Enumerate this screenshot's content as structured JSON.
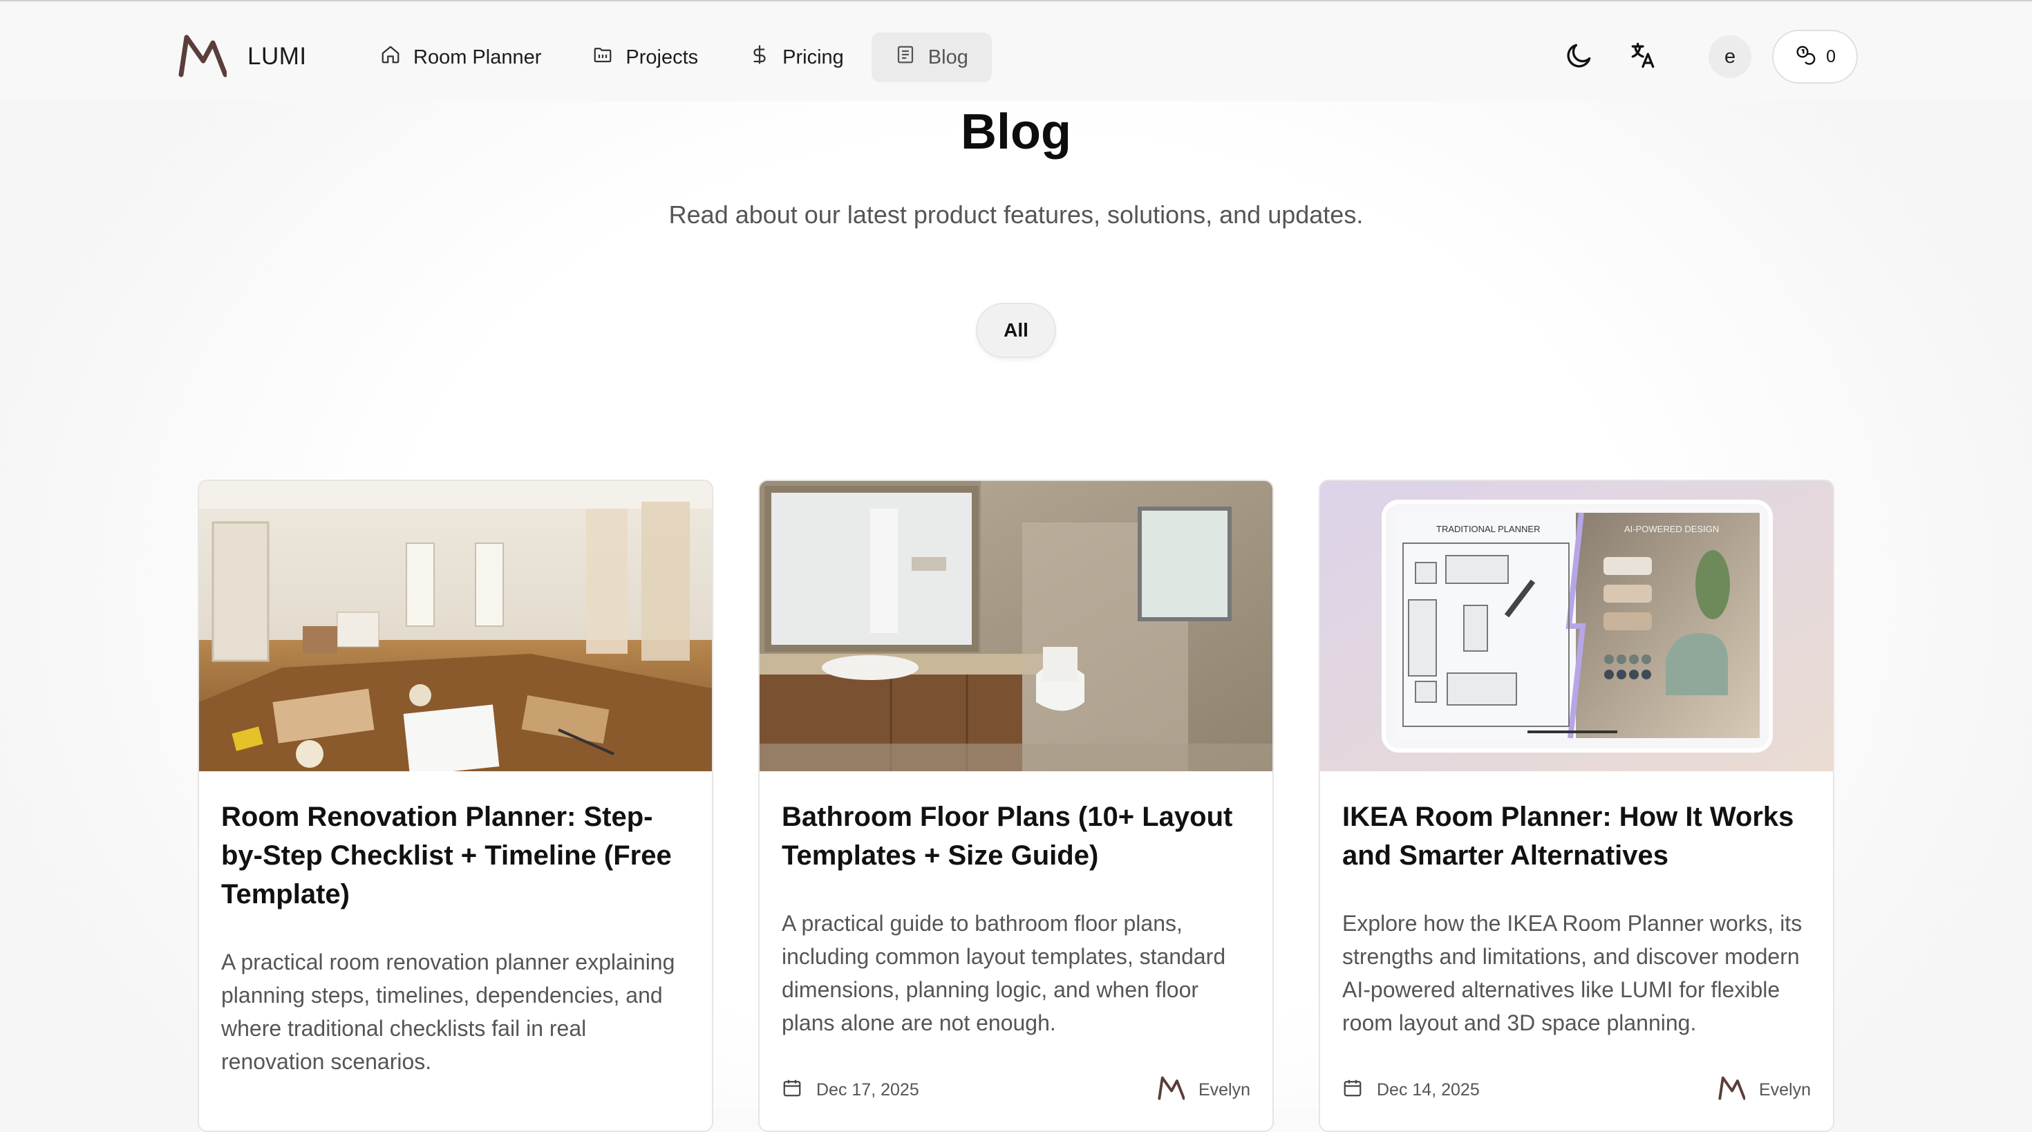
{
  "brand": {
    "name": "LUMI"
  },
  "nav": {
    "items": [
      {
        "label": "Room Planner",
        "icon": "home-icon"
      },
      {
        "label": "Projects",
        "icon": "folder-icon"
      },
      {
        "label": "Pricing",
        "icon": "dollar-icon"
      },
      {
        "label": "Blog",
        "icon": "newspaper-icon",
        "active": true
      }
    ],
    "theme_icon": "moon-icon",
    "language_icon": "translate-icon",
    "avatar_letter": "e",
    "credits_icon": "coins-icon",
    "credits_count": "0"
  },
  "hero": {
    "title": "Blog",
    "subtitle": "Read about our latest product features, solutions, and updates."
  },
  "filters": {
    "items": [
      {
        "label": "All",
        "selected": true
      }
    ]
  },
  "posts": [
    {
      "title": "Room Renovation Planner: Step-by-Step Checklist + Timeline (Free Template)",
      "excerpt": "A practical room renovation planner explaining planning steps, timelines, dependencies, and where traditional checklists fail in real renovation scenarios.",
      "image": "renovation-room-photo"
    },
    {
      "title": "Bathroom Floor Plans (10+ Layout Templates + Size Guide)",
      "excerpt": "A practical guide to bathroom floor plans, including common layout templates, standard dimensions, planning logic, and when floor plans alone are not enough.",
      "date": "Dec 17, 2025",
      "author": "Evelyn",
      "image": "bathroom-photo"
    },
    {
      "title": "IKEA Room Planner: How It Works and Smarter Alternatives",
      "excerpt": "Explore how the IKEA Room Planner works, its strengths and limitations, and discover modern AI-powered alternatives like LUMI for flexible room layout and 3D space planning.",
      "date": "Dec 14, 2025",
      "author": "Evelyn",
      "image": "tablet-planner-illustration",
      "image_labels": {
        "left": "TRADITIONAL PLANNER",
        "right": "AI-POWERED DESIGN"
      }
    }
  ],
  "colors": {
    "brand_mark": "#5a3e3a",
    "accent_bg": "#ebebeb",
    "muted_text": "#555555"
  }
}
